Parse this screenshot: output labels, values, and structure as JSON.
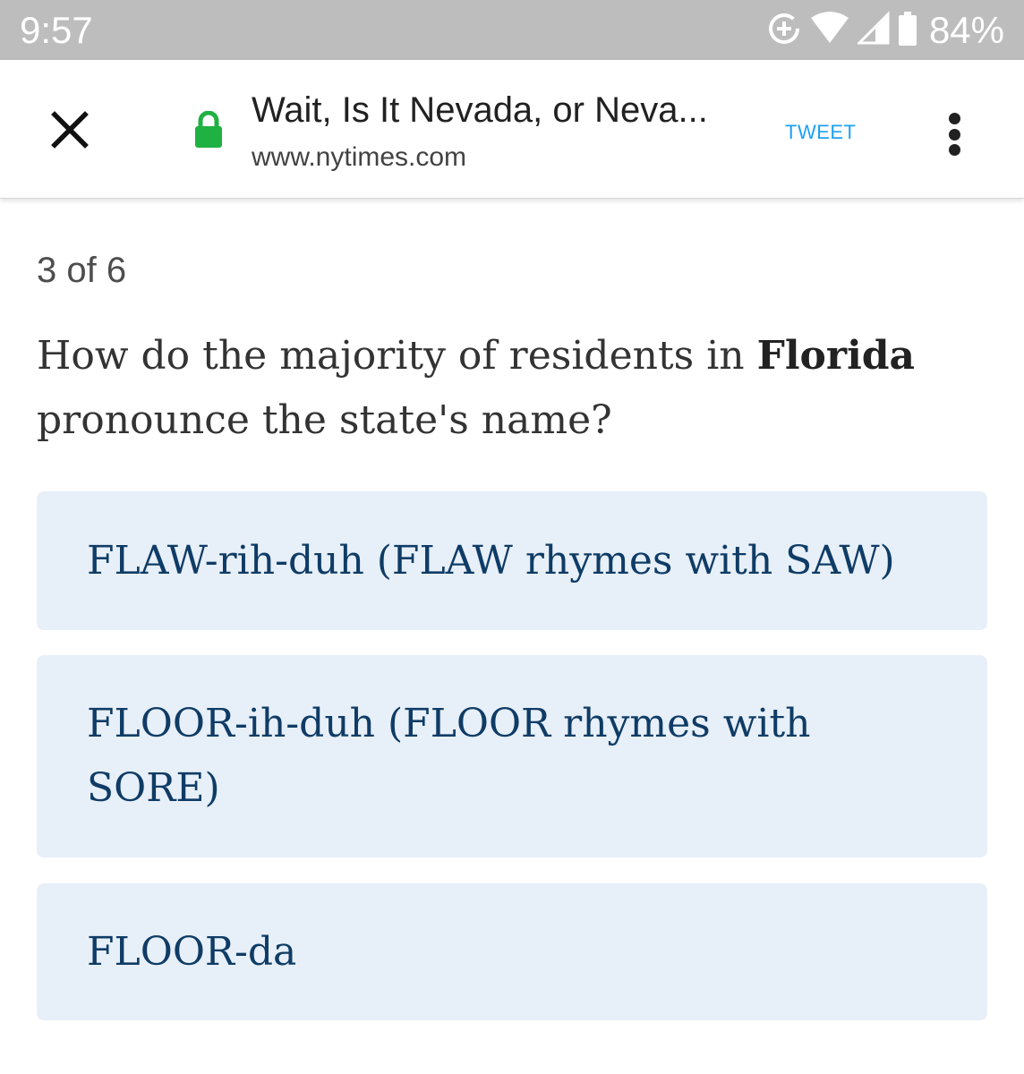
{
  "status_bar": {
    "time": "9:57",
    "battery": "84%",
    "icons": [
      "data-saver-icon",
      "wifi-icon",
      "cellular-signal-icon",
      "battery-icon"
    ]
  },
  "toolbar": {
    "title": "Wait, Is It Nevada, or Neva...",
    "url": "www.nytimes.com",
    "tweet_label": "TWEET",
    "icons": [
      "close-icon",
      "lock-icon",
      "more-vert-icon"
    ]
  },
  "quiz": {
    "progress": "3 of 6",
    "question_before": "How do the majority of residents in ",
    "question_state": "Florida",
    "question_after": " pronounce the state's name?",
    "answers": [
      "FLAW-rih-duh (FLAW rhymes with SAW)",
      "FLOOR-ih-duh (FLOOR rhymes with SORE)",
      "FLOOR-da"
    ]
  },
  "colors": {
    "status_bar": "#bdbdbd",
    "lock": "#1fb141",
    "tweet": "#1da1f2",
    "answer_bg": "#e7eff8",
    "answer_text": "#0f3c66"
  }
}
